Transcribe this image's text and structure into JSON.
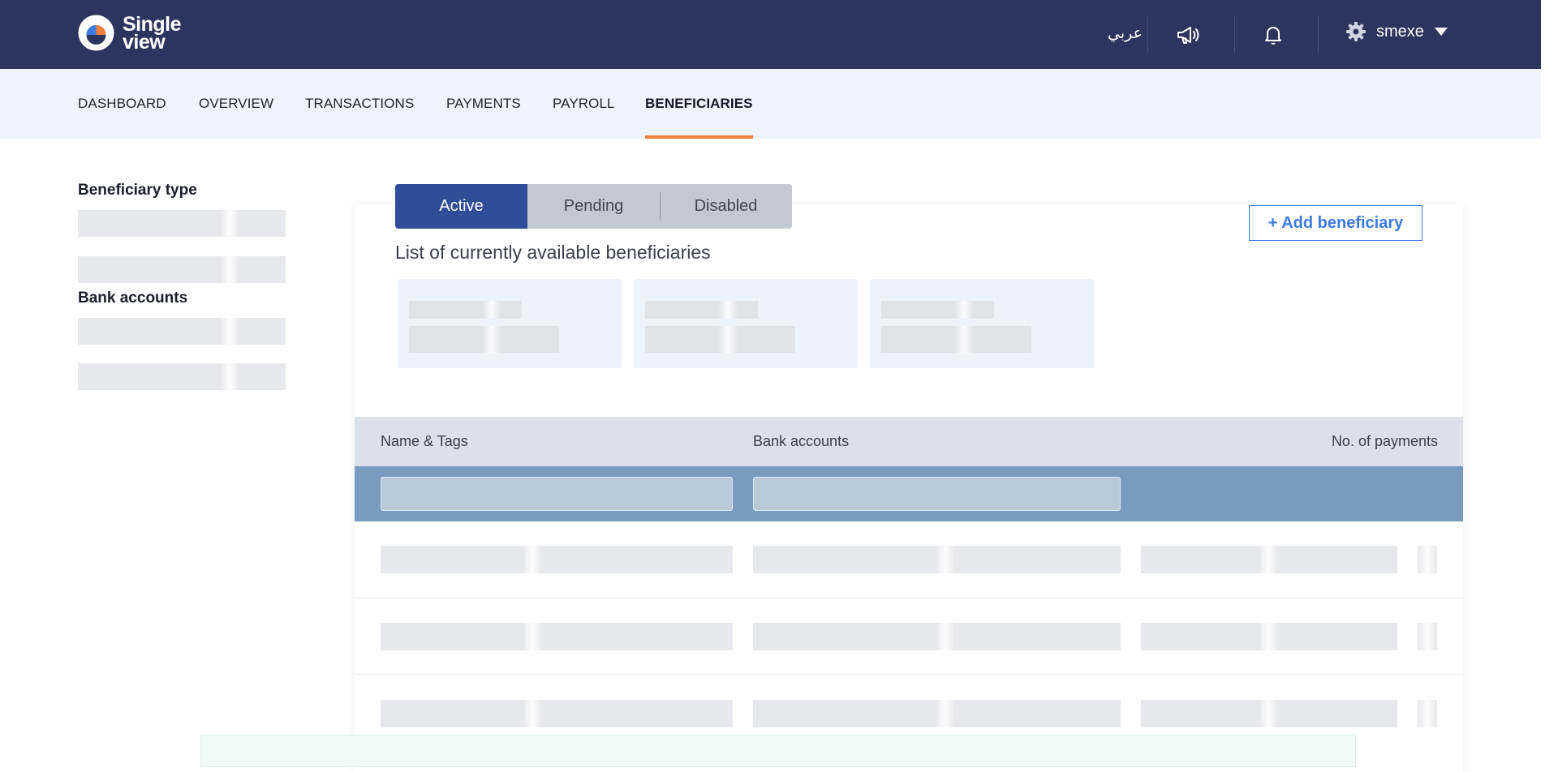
{
  "app": {
    "logo_line1": "Single",
    "logo_line2": "view"
  },
  "header": {
    "language_label": "عربي",
    "icons": [
      "megaphone-icon",
      "bell-icon",
      "gear-icon",
      "caret-down-icon"
    ],
    "username": "smexe"
  },
  "nav": {
    "items": [
      {
        "label": "DASHBOARD"
      },
      {
        "label": "OVERVIEW"
      },
      {
        "label": "TRANSACTIONS"
      },
      {
        "label": "PAYMENTS"
      },
      {
        "label": "PAYROLL"
      },
      {
        "label": "BENEFICIARIES"
      }
    ],
    "active": "BENEFICIARIES"
  },
  "sidebar": {
    "beneficiary_type_heading": "Beneficiary type",
    "bank_accounts_heading": "Bank accounts"
  },
  "main": {
    "tabs": [
      {
        "label": "Active"
      },
      {
        "label": "Pending"
      },
      {
        "label": "Disabled"
      }
    ],
    "active_tab": "Active",
    "add_button_label": "+ Add beneficiary",
    "subtitle": "List of currently available beneficiaries"
  },
  "table": {
    "columns": [
      "Name & Tags",
      "Bank accounts",
      "No. of payments"
    ]
  },
  "colors": {
    "topbar": "#2c355e",
    "nav_active_underline": "#f0803c",
    "tab_active": "#2f4e97",
    "accent_blue": "#3b7ae0",
    "filter_row": "#7a9bc0"
  }
}
